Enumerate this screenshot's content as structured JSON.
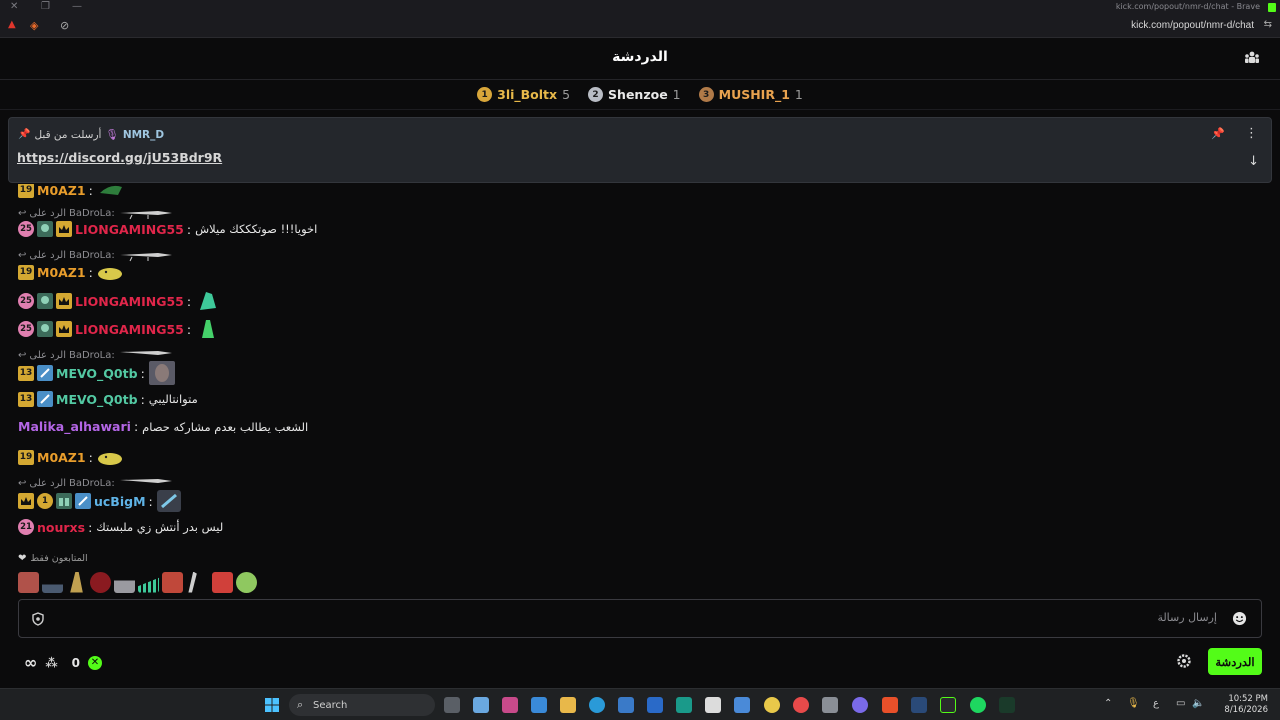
{
  "browser": {
    "window_title": "kick.com/popout/nmr-d/chat - Brave",
    "url": "kick.com/popout/nmr-d/chat"
  },
  "header": {
    "title": "الدردشة"
  },
  "leaderboard": [
    {
      "rank": "1",
      "name": "3li_Boltx",
      "count": "5",
      "badge_color": "#d8a63a",
      "name_color": "#e8b94a"
    },
    {
      "rank": "2",
      "name": "Shenzoe",
      "count": "1",
      "badge_color": "#b8bcc4",
      "name_color": "#e8e8e8"
    },
    {
      "rank": "3",
      "name": "MUSHIR_1",
      "count": "1",
      "badge_color": "#b07a48",
      "name_color": "#e8a24f"
    }
  ],
  "pinned": {
    "sent_by_label": "أرسلت من قبل",
    "user": "NMR_D",
    "link": "https://discord.gg/jU53Bdr9R"
  },
  "reply_prefix": "الرد على",
  "messages": [
    {
      "user": "M0AZ1",
      "badge": "19",
      "badge_color": "#d4a832",
      "color": "#e89d2c",
      "text": ""
    },
    {
      "reply_to": "BaDroLa:"
    },
    {
      "user": "LIONGAMING55",
      "badge": "25",
      "badge_color": "#e07fb0",
      "color": "#e0264a",
      "text": "اخويا!!! صوتكككك ميلاش"
    },
    {
      "reply_to": "BaDroLa:"
    },
    {
      "user": "M0AZ1",
      "badge": "19",
      "badge_color": "#d4a832",
      "color": "#e89d2c",
      "text": ""
    },
    {
      "user": "LIONGAMING55",
      "badge": "25",
      "badge_color": "#e07fb0",
      "color": "#e0264a",
      "text": ""
    },
    {
      "user": "LIONGAMING55",
      "badge": "25",
      "badge_color": "#e07fb0",
      "color": "#e0264a",
      "text": ""
    },
    {
      "reply_to": "BaDroLa:"
    },
    {
      "user": "MEVO_Q0tb",
      "badge": "13",
      "badge_color": "#d4a832",
      "color": "#53c9a3",
      "text": ""
    },
    {
      "user": "MEVO_Q0tb",
      "badge": "13",
      "badge_color": "#d4a832",
      "color": "#53c9a3",
      "text": "متوانتاليبي"
    },
    {
      "user": "Malika_alhawari",
      "color": "#b466e6",
      "text": "الشعب يطالب بعدم مشاركه حصام"
    },
    {
      "user": "M0AZ1",
      "badge": "19",
      "badge_color": "#d4a832",
      "color": "#e89d2c",
      "text": ""
    },
    {
      "reply_to": "BaDroLa:"
    },
    {
      "user": "ucBigM",
      "badge": "1",
      "badge_color": "#d4a832",
      "color": "#5fb3e6",
      "text": ""
    },
    {
      "user": "nourxs",
      "badge": "21",
      "badge_color": "#e07fb0",
      "color": "#e0264a",
      "text": "ليس بدر أنتش زي ملبستك"
    }
  ],
  "subscriber_emotes": {
    "title": "المتابعون فقط"
  },
  "input": {
    "placeholder": "إرسال رسالة"
  },
  "bottom": {
    "points": "0",
    "send_label": "الدردشة"
  },
  "taskbar": {
    "search_label": "Search",
    "time": "10:52 PM",
    "date": "8/16/2026",
    "lang": "ع"
  }
}
